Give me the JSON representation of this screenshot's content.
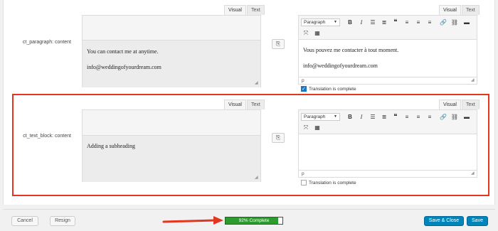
{
  "editor_tabs": {
    "visual": "Visual",
    "text": "Text"
  },
  "format_select": "Paragraph",
  "fields": [
    {
      "label": "ct_paragraph: content",
      "source_paragraphs": [
        "You can contact me at anytime.",
        "info@weddingofyourdream.com"
      ],
      "translation_paragraphs": [
        "Vous pouvez me contacter à tout moment.",
        "info@weddingofyourdream.com"
      ],
      "status_path": "p",
      "complete_label": "Translation is complete",
      "complete_checked": true
    },
    {
      "label": "ct_text_block: content",
      "source_paragraphs": [
        "Adding a subheading"
      ],
      "translation_paragraphs": [],
      "status_path": "p",
      "complete_label": "Translation is complete",
      "complete_checked": false
    }
  ],
  "footer": {
    "cancel": "Cancel",
    "resign": "Resign",
    "progress_text": "92% Complete",
    "progress_percent": 92,
    "save_close": "Save & Close",
    "save": "Save"
  },
  "colors": {
    "highlight": "#e3361e",
    "progress": "#2e9b2e",
    "primary": "#0085ba",
    "arrow": "#e3361e"
  },
  "icons": [
    "bold-icon",
    "italic-icon",
    "bullet-list-icon",
    "numbered-list-icon",
    "blockquote-icon",
    "align-left-icon",
    "align-center-icon",
    "align-right-icon",
    "link-icon",
    "unlink-icon",
    "read-more-icon",
    "fullscreen-icon",
    "kitchen-sink-icon",
    "copy-icon"
  ]
}
